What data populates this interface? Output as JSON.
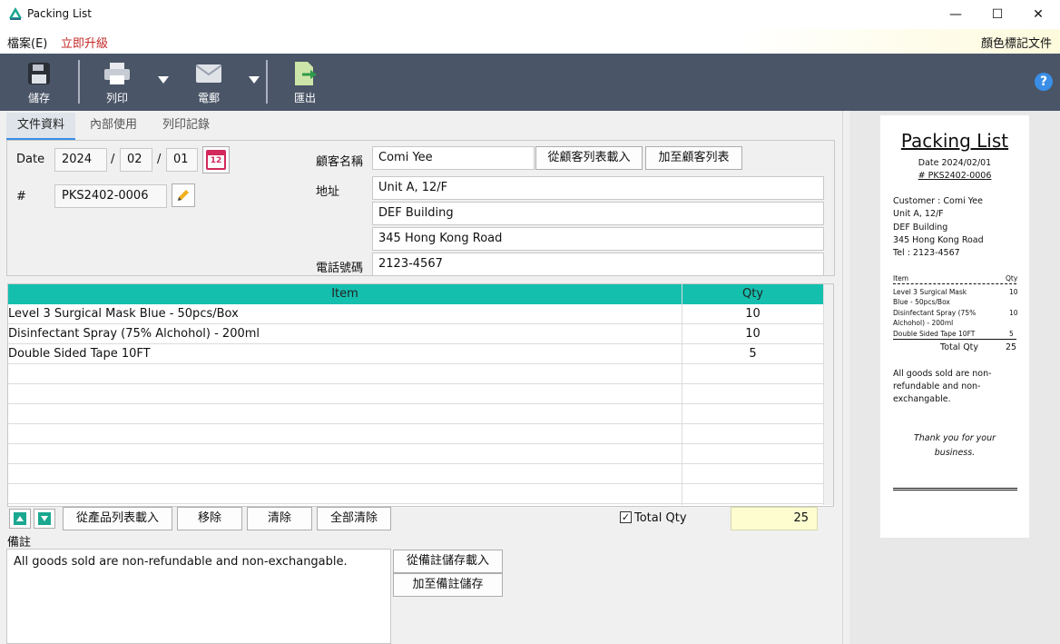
{
  "window": {
    "title": "Packing List",
    "minimize": "—",
    "maximize": "☐",
    "close": "✕"
  },
  "menu": {
    "file": "檔案(E)",
    "upgrade": "立即升級",
    "color_tag": "顏色標記文件"
  },
  "toolbar": {
    "save": "儲存",
    "print": "列印",
    "email": "電郵",
    "export": "匯出",
    "help": "?"
  },
  "tabs": [
    "文件資料",
    "內部使用",
    "列印記錄"
  ],
  "doc": {
    "date_label": "Date",
    "year": "2024",
    "month": "02",
    "day": "01",
    "date_sep": "/",
    "calendar_day": "12",
    "num_label": "#",
    "number": "PKS2402-0006"
  },
  "customer": {
    "name_label": "顧客名稱",
    "name": "Comi Yee",
    "load_btn": "從顧客列表載入",
    "add_btn": "加至顧客列表",
    "address_label": "地址",
    "address1": "Unit A, 12/F",
    "address2": "DEF Building",
    "address3": "345 Hong Kong Road",
    "phone_label": "電話號碼",
    "phone": "2123-4567"
  },
  "items": {
    "headers": {
      "item": "Item",
      "qty": "Qty"
    },
    "rows": [
      {
        "item": "Level 3 Surgical Mask Blue - 50pcs/Box",
        "qty": "10"
      },
      {
        "item": "Disinfectant Spray (75% Alchohol) - 200ml",
        "qty": "10"
      },
      {
        "item": "Double Sided Tape 10FT",
        "qty": "5"
      }
    ]
  },
  "item_actions": {
    "load": "從產品列表載入",
    "remove": "移除",
    "clear": "清除",
    "clear_all": "全部清除"
  },
  "total": {
    "label": "Total Qty",
    "checked": true,
    "value": "25"
  },
  "notes": {
    "label": "備註",
    "text": "All goods sold are non-refundable and non-exchangable.",
    "load_btn": "從備註儲存載入",
    "save_btn": "加至備註儲存"
  },
  "preview": {
    "title": "Packing List",
    "date": "Date 2024/02/01",
    "number": "# PKS2402-0006",
    "customer_line": "Customer : Comi Yee",
    "addr1": "Unit A, 12/F",
    "addr2": "DEF Building",
    "addr3": "345 Hong Kong Road",
    "tel": "Tel : 2123-4567",
    "col_item": "Item",
    "col_qty": "Qty",
    "rows": [
      {
        "l1": "Level 3 Surgical Mask",
        "l2": "Blue - 50pcs/Box",
        "qty": "10"
      },
      {
        "l1": "Disinfectant Spray (75%",
        "l2": "Alchohol) - 200ml",
        "qty": "10"
      },
      {
        "l1": "Double Sided Tape 10FT",
        "l2": "",
        "qty": "5"
      }
    ],
    "total_label": "Total Qty",
    "total_value": "25",
    "note1": "All goods sold are non-",
    "note2": "refundable and non-",
    "note3": "exchangable.",
    "thanks1": "Thank you for your",
    "thanks2": "business."
  },
  "colors": {
    "accent": "#15bfae",
    "toolbar": "#4a5567",
    "total_bg": "#fdfdd0"
  }
}
